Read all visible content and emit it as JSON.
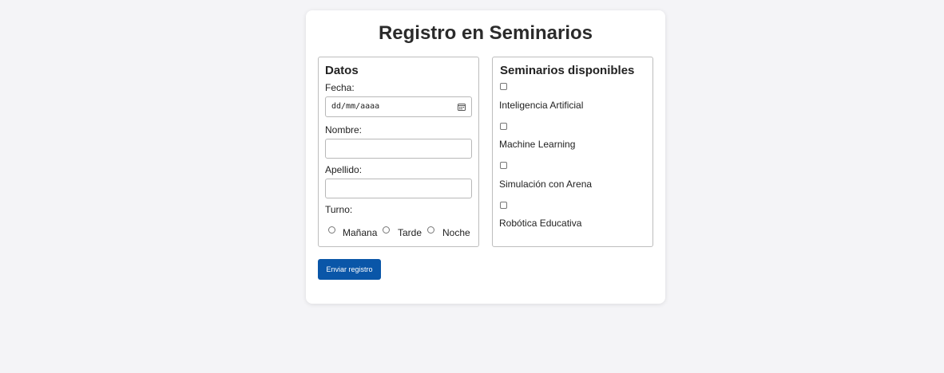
{
  "form": {
    "title": "Registro en Seminarios",
    "submit_label": "Enviar registro"
  },
  "datos": {
    "legend": "Datos",
    "fecha_label": "Fecha:",
    "fecha_placeholder": "dd/mm/aaaa",
    "nombre_label": "Nombre:",
    "nombre_value": "",
    "apellido_label": "Apellido:",
    "apellido_value": "",
    "turno_label": "Turno:",
    "turnos": [
      "Mañana",
      "Tarde",
      "Noche"
    ]
  },
  "seminarios": {
    "legend": "Seminarios disponibles",
    "items": [
      "Inteligencia Artificial",
      "Machine Learning",
      "Simulación con Arena",
      "Robótica Educativa"
    ]
  },
  "icons": {
    "date": "calendar-icon"
  },
  "colors": {
    "background": "#f4f4f7",
    "card": "#ffffff",
    "button": "#0a56a8"
  }
}
